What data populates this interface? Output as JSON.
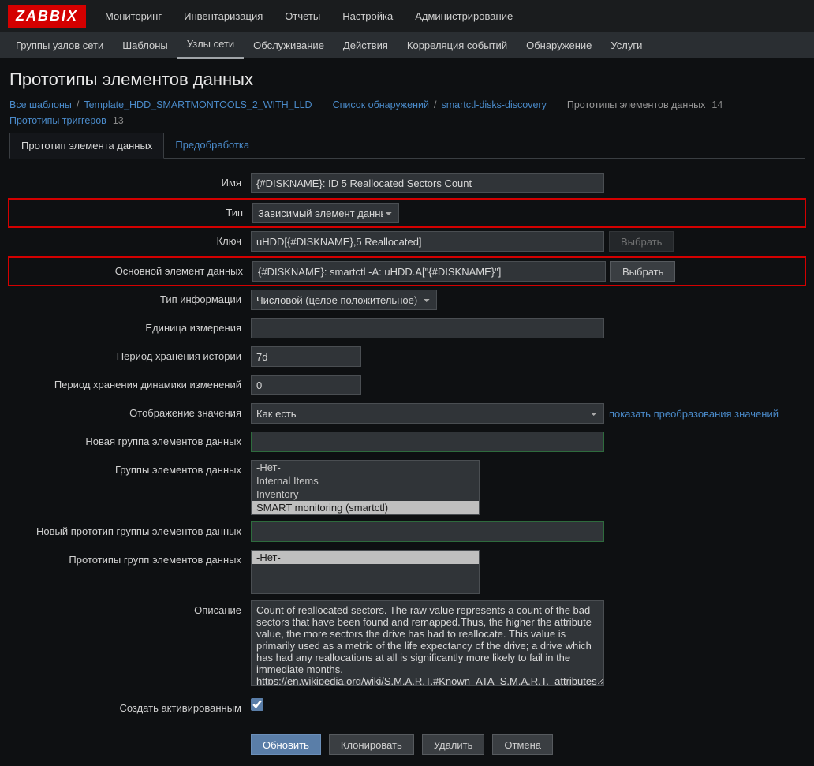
{
  "logo": "ZABBIX",
  "topnav": [
    "Мониторинг",
    "Инвентаризация",
    "Отчеты",
    "Настройка",
    "Администрирование"
  ],
  "topnav_active": 3,
  "subnav": [
    "Группы узлов сети",
    "Шаблоны",
    "Узлы сети",
    "Обслуживание",
    "Действия",
    "Корреляция событий",
    "Обнаружение",
    "Услуги"
  ],
  "subnav_active": 2,
  "page_title": "Прототипы элементов данных",
  "breadcrumb": [
    {
      "text": "Все шаблоны",
      "link": true
    },
    {
      "text": "Template_HDD_SMARTMONTOOLS_2_WITH_LLD",
      "link": true
    },
    {
      "text": "Список обнаружений",
      "link": true,
      "gap": true
    },
    {
      "text": "smartctl-disks-discovery",
      "link": true
    },
    {
      "text": "Прототипы элементов данных",
      "link": false,
      "count": "14",
      "gap": true
    },
    {
      "text": "Прототипы триггеров",
      "link": true,
      "count": "13",
      "gap": true
    }
  ],
  "tabs": [
    "Прототип элемента данных",
    "Предобработка"
  ],
  "tabs_active": 0,
  "labels": {
    "name": "Имя",
    "type": "Тип",
    "key": "Ключ",
    "master": "Основной элемент данных",
    "info_type": "Тип информации",
    "units": "Единица измерения",
    "history": "Период хранения истории",
    "trends": "Период хранения динамики изменений",
    "valuemap": "Отображение значения",
    "new_app": "Новая группа элементов данных",
    "apps": "Группы элементов данных",
    "new_app_proto": "Новый прототип группы элементов данных",
    "app_protos": "Прототипы групп элементов данных",
    "description": "Описание",
    "enabled": "Создать активированным"
  },
  "values": {
    "name": "{#DISKNAME}: ID 5 Reallocated Sectors Count",
    "type": "Зависимый элемент данных",
    "key": "uHDD[{#DISKNAME},5 Reallocated]",
    "master": "{#DISKNAME}: smartctl -A: uHDD.A[\"{#DISKNAME}\"]",
    "info_type": "Числовой (целое положительное)",
    "units": "",
    "history": "7d",
    "trends": "0",
    "valuemap": "Как есть",
    "new_app": "",
    "new_app_proto": "",
    "description": "Count of reallocated sectors. The raw value represents a count of the bad sectors that have been found and remapped.Thus, the higher the attribute value, the more sectors the drive has had to reallocate. This value is primarily used as a metric of the life expectancy of the drive; a drive which has had any reallocations at all is significantly more likely to fail in the immediate months.\nhttps://en.wikipedia.org/wiki/S.M.A.R.T.#Known_ATA_S.M.A.R.T._attributes"
  },
  "apps_options": [
    {
      "label": "-Нет-",
      "selected": false
    },
    {
      "label": "Internal Items",
      "selected": false
    },
    {
      "label": "Inventory",
      "selected": false
    },
    {
      "label": "SMART monitoring (smartctl)",
      "selected": true
    }
  ],
  "app_protos_options": [
    {
      "label": "-Нет-",
      "selected": true
    }
  ],
  "buttons": {
    "select": "Выбрать",
    "show_valuemaps": "показать преобразования значений",
    "update": "Обновить",
    "clone": "Клонировать",
    "delete": "Удалить",
    "cancel": "Отмена"
  }
}
